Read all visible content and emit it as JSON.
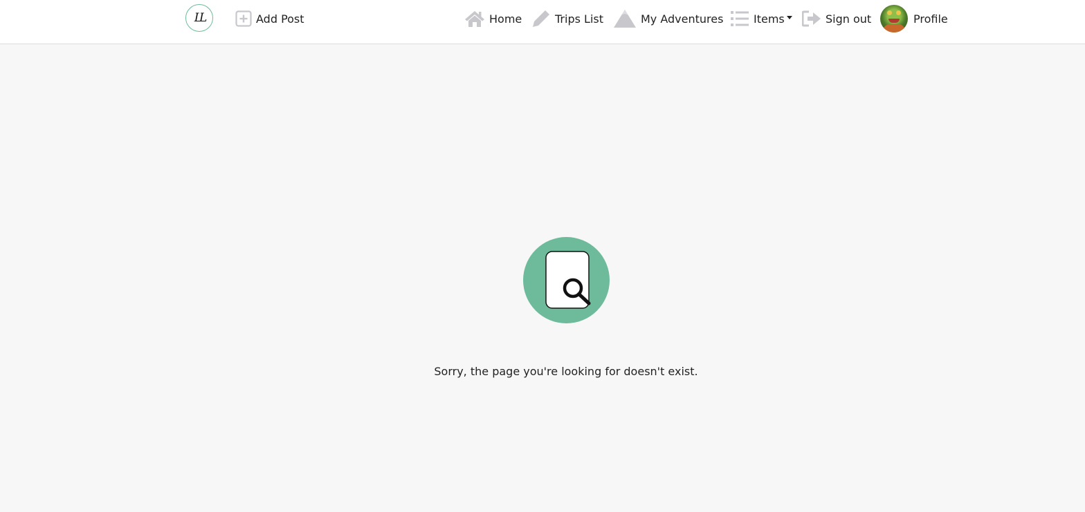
{
  "navbar": {
    "logo_text": "LL",
    "add_post_label": "Add Post",
    "home_label": "Home",
    "trips_list_label": "Trips List",
    "my_adventures_label": "My Adventures",
    "items_label": "Items",
    "sign_out_label": "Sign out",
    "profile_label": "Profile"
  },
  "icons": {
    "add_post": "plus-square-icon",
    "home": "home-icon",
    "trips_list": "pencil-icon",
    "my_adventures": "mountain-icon",
    "items": "list-icon",
    "sign_out": "sign-out-icon",
    "empty_state": "document-search-icon"
  },
  "colors": {
    "accent": "#6dbb9b",
    "icon_gray": "#c7c7cc",
    "background": "#f7f7f7"
  },
  "main": {
    "error_message": "Sorry, the page you're looking for doesn't exist."
  }
}
